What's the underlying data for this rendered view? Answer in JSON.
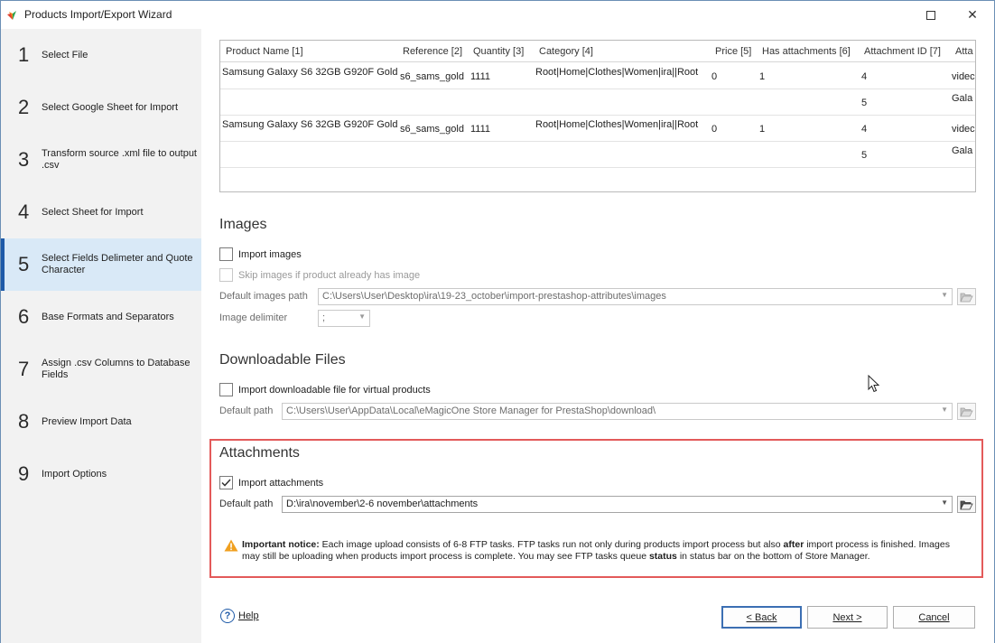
{
  "window": {
    "title": "Products Import/Export Wizard",
    "maximize_label": "",
    "close_label": "✕"
  },
  "sidebar": {
    "steps": [
      {
        "num": "1",
        "label": "Select File"
      },
      {
        "num": "2",
        "label": "Select Google Sheet for Import"
      },
      {
        "num": "3",
        "label": "Transform source .xml file to output .csv"
      },
      {
        "num": "4",
        "label": "Select Sheet for Import"
      },
      {
        "num": "5",
        "label": "Select Fields Delimeter and Quote Character"
      },
      {
        "num": "6",
        "label": "Base Formats and Separators"
      },
      {
        "num": "7",
        "label": "Assign .csv Columns to Database Fields"
      },
      {
        "num": "8",
        "label": "Preview Import Data"
      },
      {
        "num": "9",
        "label": "Import Options"
      }
    ],
    "active_step": 5
  },
  "grid": {
    "columns": [
      "Product Name [1]",
      "Reference [2]",
      "Quantity [3]",
      "Category [4]",
      "Price [5]",
      "Has attachments [6]",
      "Attachment ID [7]",
      "Atta"
    ],
    "rows": [
      [
        "Samsung Galaxy S6 32GB G920F Gold",
        "s6_sams_gold",
        "1111",
        "Root|Home|Clothes|Women|ira||Root",
        "0",
        "1",
        "4",
        "videc"
      ],
      [
        "",
        "",
        "",
        "",
        "",
        "",
        "5",
        "Gala"
      ],
      [
        "Samsung Galaxy S6 32GB G920F Gold",
        "s6_sams_gold",
        "1111",
        "Root|Home|Clothes|Women|ira||Root",
        "0",
        "1",
        "4",
        "videc"
      ],
      [
        "",
        "",
        "",
        "",
        "",
        "",
        "5",
        "Gala"
      ]
    ]
  },
  "images": {
    "title": "Images",
    "import_label": "Import images",
    "import_checked": false,
    "skip_label": "Skip images if product already has image",
    "path_label": "Default images path",
    "path_value": "C:\\Users\\User\\Desktop\\ira\\19-23_october\\import-prestashop-attributes\\images",
    "delimiter_label": "Image delimiter",
    "delimiter_value": ";"
  },
  "downloadable": {
    "title": "Downloadable Files",
    "import_label": "Import downloadable file for virtual products",
    "import_checked": false,
    "path_label": "Default path",
    "path_value": "C:\\Users\\User\\AppData\\Local\\eMagicOne Store Manager for PrestaShop\\download\\"
  },
  "attachments": {
    "title": "Attachments",
    "import_label": "Import attachments",
    "import_checked": true,
    "path_label": "Default path",
    "path_value": "D:\\ira\\november\\2-6 november\\attachments"
  },
  "notice": {
    "heading": "Important notice:",
    "text1": " Each image upload consists of 6-8 FTP tasks. FTP tasks run not only during products import process but also ",
    "bold1": "after",
    "text2": " import process is finished. Images may still be uploading when products import process is complete. You may see FTP tasks queue ",
    "bold2": "status",
    "text3": " in status bar on the bottom of Store Manager."
  },
  "footer": {
    "help_label": "Help",
    "back_label": "< Back",
    "next_label": "Next >",
    "cancel_label": "Cancel"
  },
  "colors": {
    "accent": "#1e5aa8",
    "active_step_bg": "#d9e9f7",
    "highlight_border": "#e35a5a",
    "warning": "#f0a020"
  }
}
